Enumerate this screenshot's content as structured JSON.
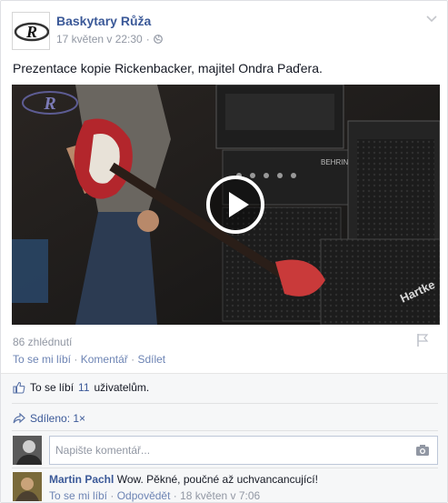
{
  "post": {
    "page_name": "Baskytary Růža",
    "timestamp": "17 květen v 22:30",
    "separator": "·",
    "privacy_icon": "globe-icon",
    "text": "Prezentace kopie Rickenbacker, majitel Ondra Paďera.",
    "video": {
      "play_icon": "play-icon",
      "amp_brand_1": "BEHRINGER",
      "amp_brand_2": "Hartke"
    },
    "views": "86 zhlédnutí",
    "actions": {
      "like": "To se mi líbí",
      "comment": "Komentář",
      "share": "Sdílet",
      "dot": "·"
    }
  },
  "feedback": {
    "likes_prefix": "To se líbí",
    "likes_count": "11",
    "likes_suffix": "uživatelům.",
    "shares_label": "Sdíleno: 1×",
    "comment_placeholder": "Napište komentář..."
  },
  "comments": [
    {
      "author": "Martin Pachl",
      "text": "Wow. Pěkné, poučné až uchvancancující!",
      "like": "To se mi líbí",
      "reply": "Odpovědět",
      "time": "18 květen v 7:06",
      "dot": "·"
    }
  ],
  "colors": {
    "link": "#3b5998",
    "muted": "#9197a3",
    "action": "#6d84b4",
    "feedback_bg": "#f6f7f8"
  }
}
